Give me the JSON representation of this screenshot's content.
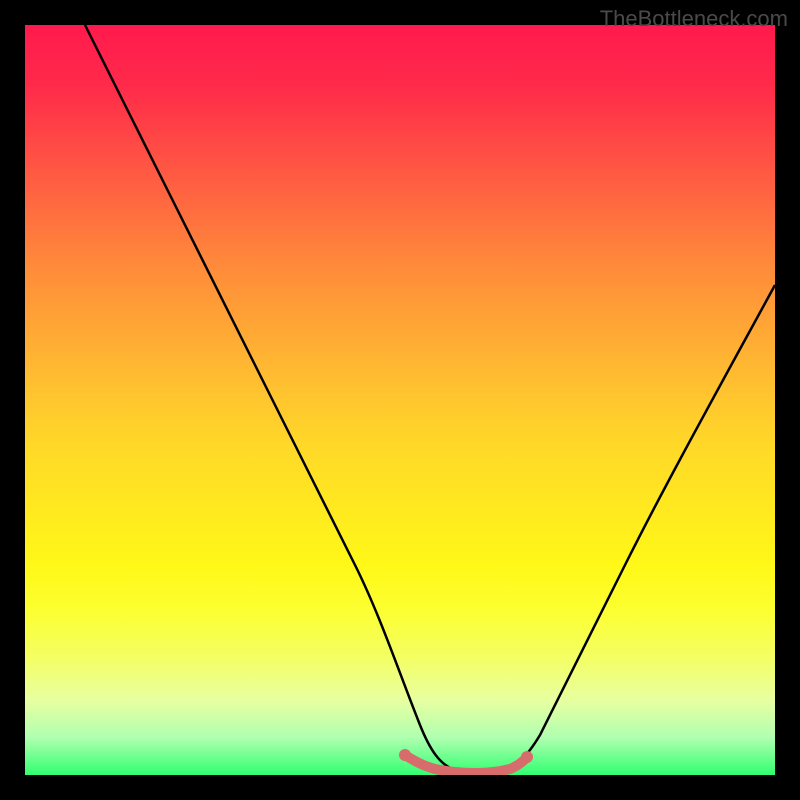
{
  "watermark": "TheBottleneck.com",
  "chart_data": {
    "type": "line",
    "title": "",
    "xlabel": "",
    "ylabel": "",
    "xlim": [
      0,
      100
    ],
    "ylim": [
      0,
      100
    ],
    "series": [
      {
        "name": "bottleneck-curve",
        "x": [
          8,
          12,
          16,
          20,
          24,
          28,
          32,
          36,
          40,
          44,
          48,
          50,
          52,
          54,
          56,
          58,
          60,
          62,
          64,
          68,
          72,
          76,
          80,
          84,
          88,
          92,
          96,
          100
        ],
        "y": [
          100,
          92,
          84,
          76,
          68,
          60,
          52,
          44,
          36,
          28,
          20,
          14,
          8,
          4,
          2,
          1,
          1,
          1,
          2,
          5,
          10,
          17,
          25,
          33,
          42,
          51,
          60,
          70
        ]
      },
      {
        "name": "optimal-zone",
        "x": [
          50,
          52,
          54,
          56,
          58,
          60,
          62,
          64
        ],
        "y": [
          3,
          2,
          1.5,
          1,
          1,
          1,
          1.5,
          2
        ]
      }
    ],
    "gradient_stops": [
      {
        "pos": 0,
        "color": "#ff1a4d"
      },
      {
        "pos": 50,
        "color": "#ffd828"
      },
      {
        "pos": 100,
        "color": "#30ff70"
      }
    ]
  }
}
